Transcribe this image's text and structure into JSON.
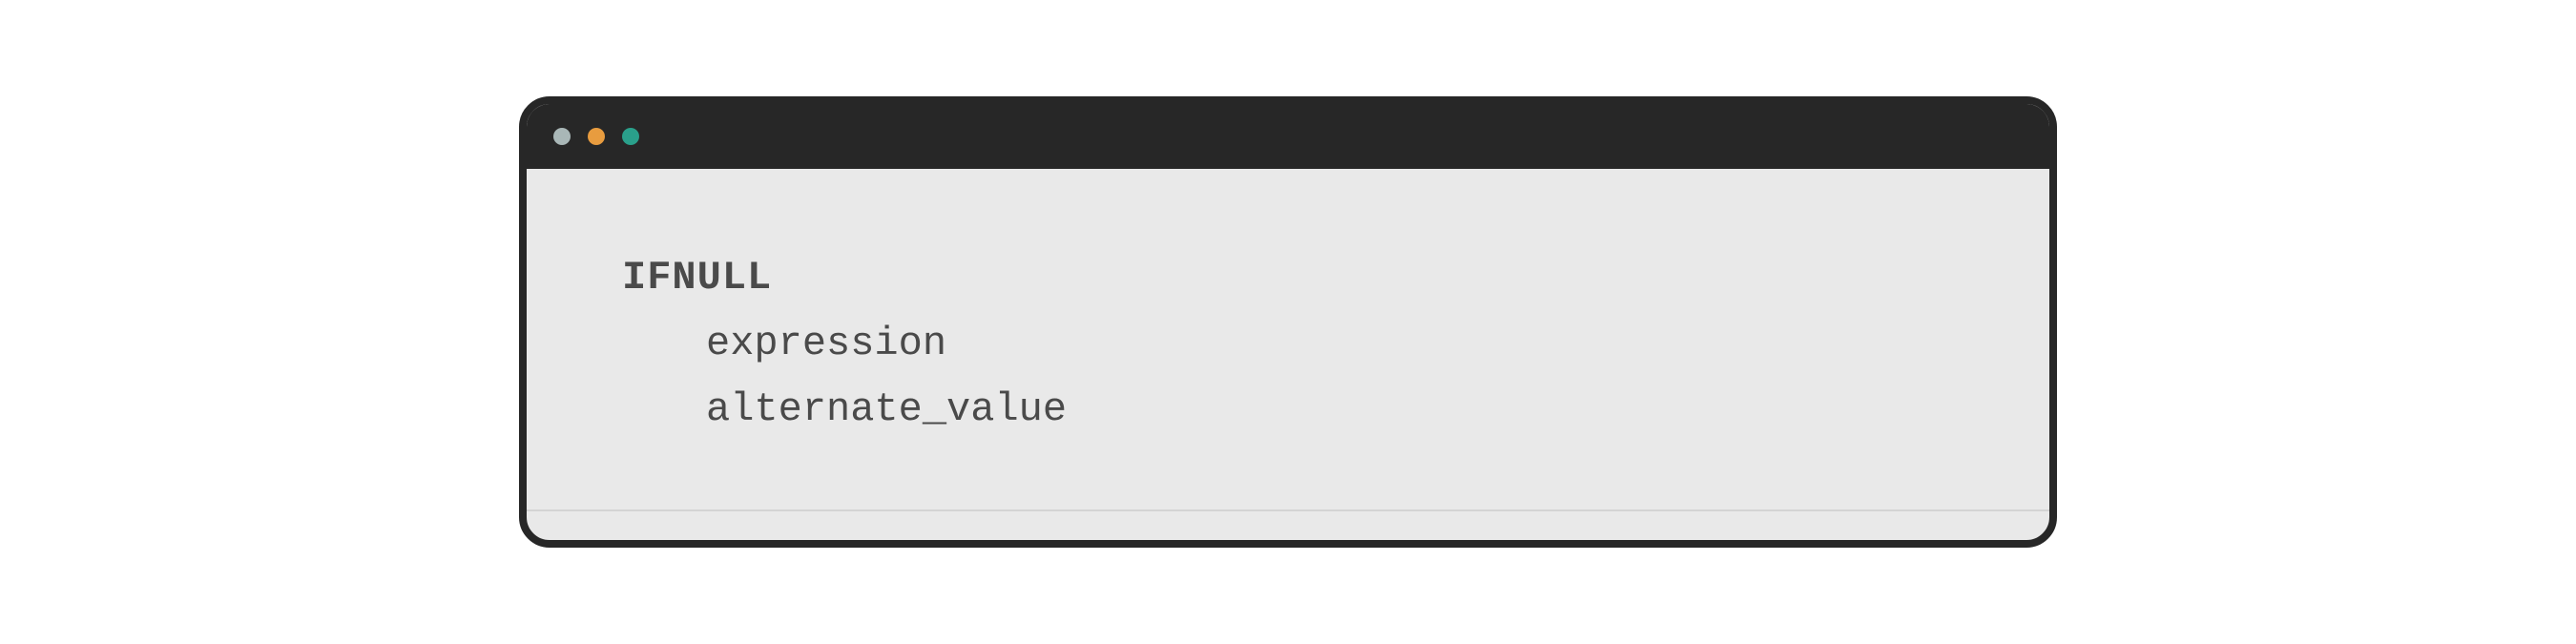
{
  "code": {
    "function_name": "IFNULL",
    "param1": "expression",
    "param2": "alternate_value"
  },
  "window": {
    "traffic_lights": {
      "close_color": "#a9b7b7",
      "minimize_color": "#e89c3f",
      "maximize_color": "#2aa08b"
    }
  }
}
